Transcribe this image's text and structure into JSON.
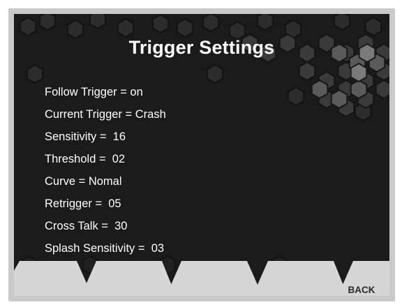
{
  "screen": {
    "title": "Trigger Settings",
    "settings": [
      "Follow Trigger = on",
      "Current Trigger = Crash",
      "Sensitivity =  16",
      "Threshold =  02",
      "Curve = Nomal",
      "Retrigger =  05",
      "Cross Talk =  30",
      "Splash Sensitivity =  03"
    ],
    "softkeys": [
      "",
      "",
      "",
      "",
      "BACK"
    ]
  },
  "colors": {
    "screen_background": "#1b1b1b",
    "bezel": "#c9c9c9",
    "softkey_fill": "#d6d6d6",
    "text": "#ffffff"
  }
}
